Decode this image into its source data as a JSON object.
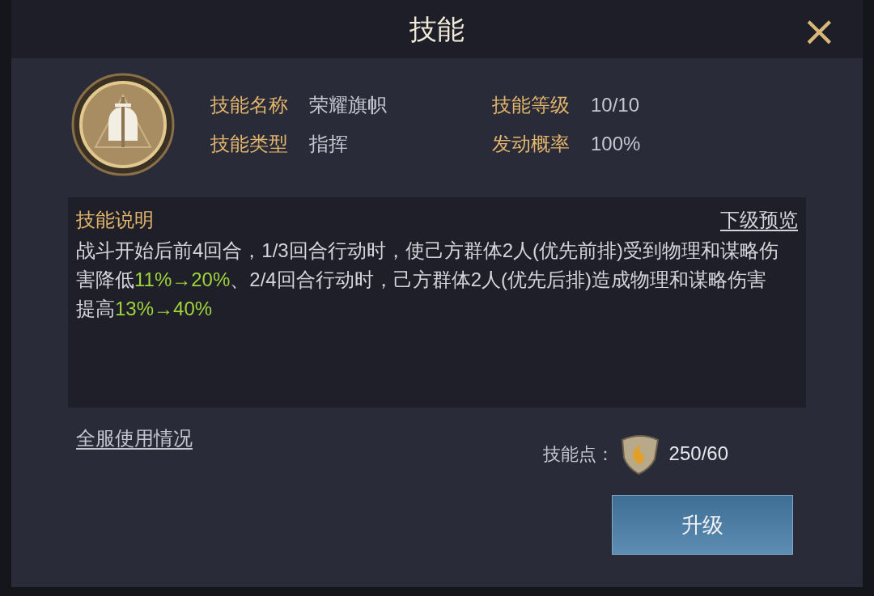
{
  "dialog": {
    "title": "技能",
    "close": "×"
  },
  "info": [
    {
      "label": "技能名称",
      "value": "荣耀旗帜"
    },
    {
      "label": "技能等级",
      "value": "10/10"
    },
    {
      "label": "技能类型",
      "value": "指挥"
    },
    {
      "label": "发动概率",
      "value": "100%"
    }
  ],
  "description": {
    "heading": "技能说明",
    "preview_link": "下级预览",
    "segments": [
      {
        "text": "战斗开始后前4回合，1/3回合行动时，使己方群体2人(优先前排)受到物理和谋略伤害降低",
        "highlight": false
      },
      {
        "text": "11%→20%",
        "highlight": true
      },
      {
        "text": "、2/4回合行动时，己方群体2人(优先后排)造成物理和谋略伤害提高",
        "highlight": false
      },
      {
        "text": "13%→40%",
        "highlight": true
      }
    ]
  },
  "usage_link": "全服使用情况",
  "skill_points": {
    "label": "技能点：",
    "value": "250/60"
  },
  "upgrade_button": "升级"
}
